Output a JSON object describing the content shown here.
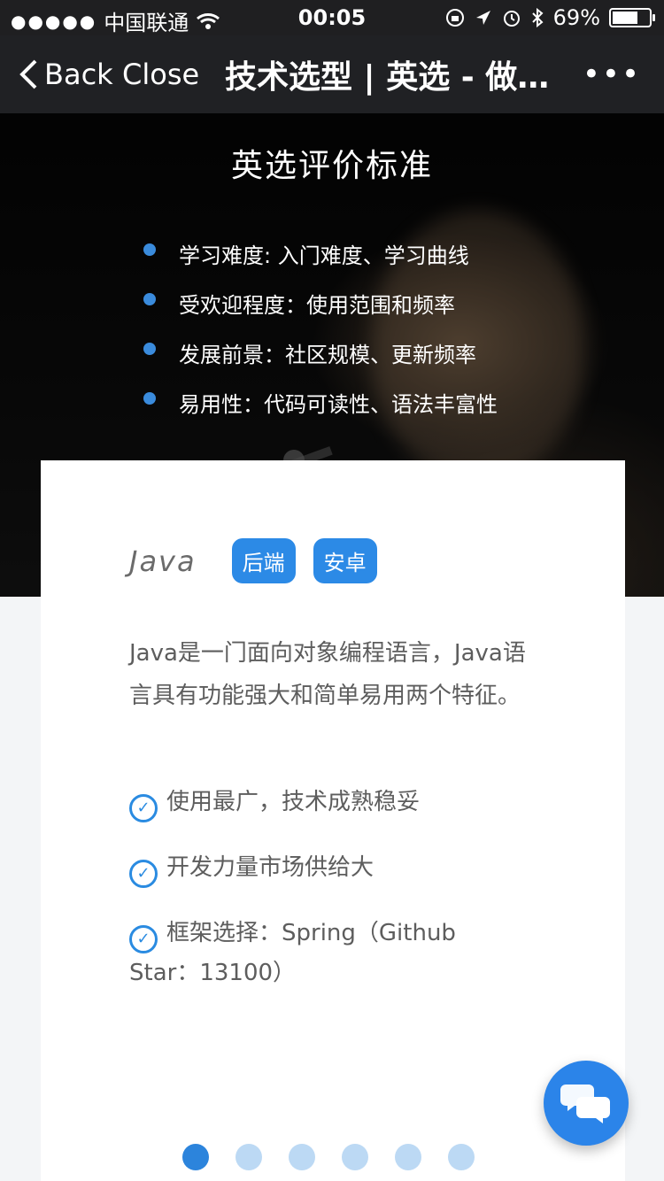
{
  "status_bar": {
    "signal": "●●●●●",
    "carrier": "中国联通",
    "time": "00:05",
    "battery": "69%",
    "battery_level": 0.69
  },
  "nav": {
    "back_label": "Back",
    "close_label": "Close",
    "title": "技术选型 | 英选 - 做真...",
    "more_label": "•••"
  },
  "hero": {
    "title": "英选评价标准",
    "criteria": [
      {
        "text": "学习难度: 入门难度、学习曲线"
      },
      {
        "text": "受欢迎程度：使用范围和频率"
      },
      {
        "text": "发展前景：社区规模、更新频率"
      },
      {
        "text": "易用性：代码可读性、语法丰富性"
      }
    ]
  },
  "card": {
    "language": "Java",
    "tags": [
      "后端",
      "安卓"
    ],
    "description": "Java是一门面向对象编程语言，Java语言具有功能强大和简单易用两个特征。",
    "features": [
      "使用最广，技术成熟稳妥",
      "开发力量市场供给大",
      "框架选择：Spring（Github Star：13100）"
    ]
  },
  "pager": {
    "count": 6,
    "active_index": 0
  },
  "colors": {
    "accent": "#2c8ae6",
    "navbar_bg": "#202124",
    "pager_inactive": "#bcd9f4"
  }
}
